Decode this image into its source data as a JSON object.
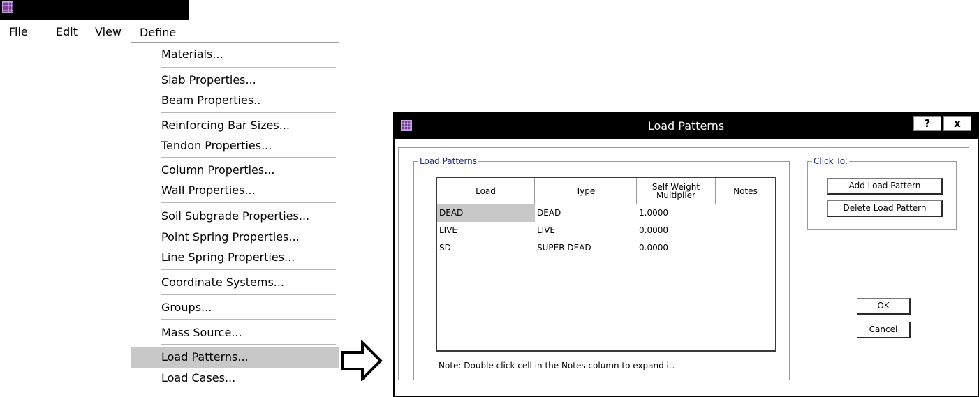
{
  "menubar": {
    "items": [
      "File",
      "Edit",
      "View",
      "Define"
    ]
  },
  "define_menu": {
    "items": [
      "Materials...",
      "Slab Properties...",
      "Beam Properties..",
      "Reinforcing Bar Sizes...",
      "Tendon Properties...",
      "Column Properties...",
      "Wall Properties...",
      "Soil Subgrade Properties...",
      "Point Spring Properties...",
      "Line Spring Properties...",
      "Coordinate Systems...",
      "Groups...",
      "Mass Source...",
      "Load Patterns...",
      "Load Cases..."
    ],
    "highlighted": "Load Patterns..."
  },
  "dialog": {
    "title": "Load Patterns",
    "help_label": "?",
    "close_label": "x",
    "group_load_patterns": "Load Patterns",
    "group_click_to": "Click To:",
    "columns": [
      "Load",
      "Type",
      "Self Weight Multiplier",
      "Notes"
    ],
    "rows": [
      {
        "load": "DEAD",
        "type": "DEAD",
        "multiplier": "1.0000",
        "notes": ""
      },
      {
        "load": "LIVE",
        "type": "LIVE",
        "multiplier": "0.0000",
        "notes": ""
      },
      {
        "load": "SD",
        "type": "SUPER DEAD",
        "multiplier": "0.0000",
        "notes": ""
      }
    ],
    "note": "Note:  Double click cell in the Notes column to expand it.",
    "add_button": "Add Load Pattern",
    "delete_button": "Delete Load Pattern",
    "ok_button": "OK",
    "cancel_button": "Cancel"
  },
  "colors": {
    "titlebar": "#000000",
    "highlight": "#c8c8c8",
    "legend_text": "#1a2f8a",
    "app_icon": "#7b3fa0"
  }
}
